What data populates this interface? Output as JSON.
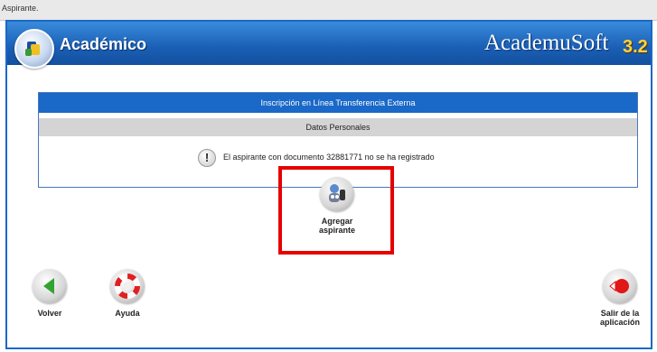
{
  "window": {
    "title": "Aspirante."
  },
  "header": {
    "module": "Académico",
    "brand": "AcademuSoft",
    "version": "3.2"
  },
  "form": {
    "title": "Inscripción en Línea Transferencia Externa",
    "section": "Datos Personales",
    "message": "El aspirante con documento 32881771 no se ha registrado"
  },
  "actions": {
    "add": {
      "label_line1": "Agregar",
      "label_line2": "aspirante"
    },
    "back": {
      "label": "Volver"
    },
    "help": {
      "label": "Ayuda"
    },
    "exit": {
      "label_line1": "Salir de la",
      "label_line2": "aplicación"
    }
  },
  "colors": {
    "primary": "#1a68c7",
    "highlight": "#e60000",
    "back_arrow": "#33a333",
    "exit_red": "#e01818"
  }
}
